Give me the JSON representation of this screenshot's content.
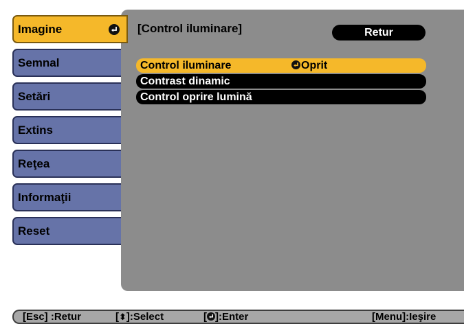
{
  "menu": {
    "items": [
      {
        "label": "Imagine",
        "selected": true
      },
      {
        "label": "Semnal"
      },
      {
        "label": "Setări"
      },
      {
        "label": "Extins"
      },
      {
        "label": "Reţea"
      },
      {
        "label": "Informaţii"
      },
      {
        "label": "Reset"
      }
    ],
    "selected_icon": "enter-icon"
  },
  "panel": {
    "title": "[Control iluminare]",
    "return_label": "Retur",
    "options": [
      {
        "label": "Control iluminare",
        "value": "Oprit",
        "value_icon": "enter-icon",
        "selected": true
      },
      {
        "label": "Contrast dinamic"
      },
      {
        "label": "Control oprire lumină"
      }
    ]
  },
  "help_bar": {
    "esc": "[Esc] :Retur",
    "select_open": "[",
    "select_close": "]:Select",
    "select_icon": "up-down-arrow-icon",
    "enter_open": "[",
    "enter_close": "]:Enter",
    "enter_icon": "enter-icon",
    "menu": "[Menu]:Ieşire"
  },
  "colors": {
    "selected": "#f5b82a",
    "menu_button": "#6673a8",
    "panel": "#8c8c8c",
    "option_row": "#000000",
    "help_bar": "#a7a7a7"
  }
}
